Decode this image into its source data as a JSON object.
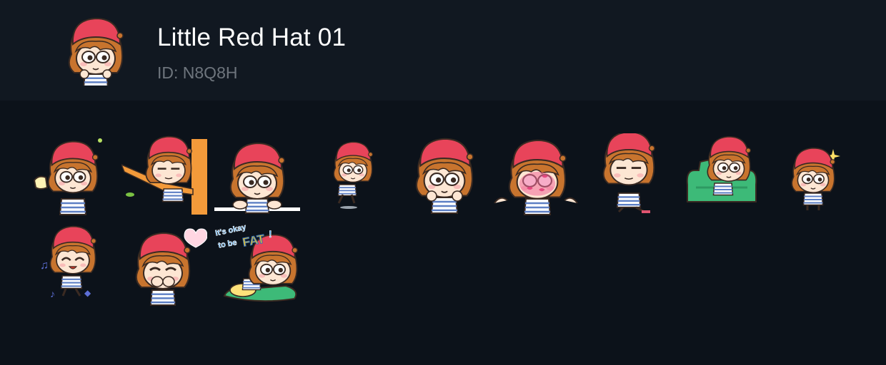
{
  "pack": {
    "title": "Little Red Hat 01",
    "id_text": "ID: N8Q8H"
  },
  "caption_sticker": {
    "line1": "It's okay",
    "line2": "to be",
    "word": "FAT",
    "mark": "!"
  },
  "colors": {
    "header_bg": "#111821",
    "page_bg": "#0c121a",
    "hat": "#e8445a",
    "hair": "#c8742e",
    "skin": "#fde6d3",
    "stripe": "#5d7fc4",
    "outline": "#3a2a22",
    "title": "#ffffff",
    "id": "#6e757d"
  },
  "stickers": [
    {
      "name": "sticker-drinking",
      "icon": "girl-drinking-icon"
    },
    {
      "name": "sticker-tree-branch",
      "icon": "girl-on-branch-icon"
    },
    {
      "name": "sticker-peeking",
      "icon": "girl-peeking-icon"
    },
    {
      "name": "sticker-jumping",
      "icon": "girl-jumping-icon"
    },
    {
      "name": "sticker-pointing",
      "icon": "girl-pointing-icon"
    },
    {
      "name": "sticker-kiss-marks",
      "icon": "girl-kissed-icon"
    },
    {
      "name": "sticker-annoyed",
      "icon": "girl-annoyed-icon"
    },
    {
      "name": "sticker-sofa",
      "icon": "girl-on-sofa-icon"
    },
    {
      "name": "sticker-sparkle",
      "icon": "girl-sparkle-icon"
    },
    {
      "name": "sticker-dancing",
      "icon": "girl-dancing-icon"
    },
    {
      "name": "sticker-heart",
      "icon": "girl-heart-icon"
    },
    {
      "name": "sticker-fat",
      "icon": "girl-lying-fat-icon"
    }
  ]
}
